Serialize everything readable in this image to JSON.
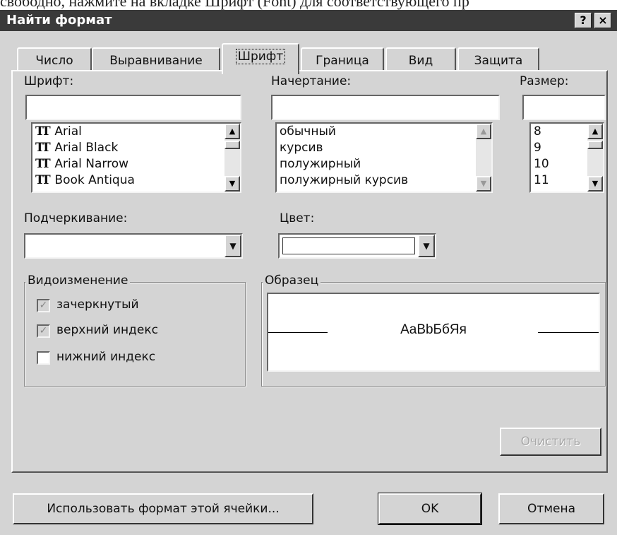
{
  "document_strip": {
    "text": "свободно, нажмите на вкладке Шрифт (Font) для соответствующего пр"
  },
  "titlebar": {
    "title": "Найти формат",
    "help_label": "?",
    "close_label": "×"
  },
  "tabs": [
    {
      "label": "Число"
    },
    {
      "label": "Выравнивание"
    },
    {
      "label": "Шрифт",
      "active": true
    },
    {
      "label": "Граница"
    },
    {
      "label": "Вид"
    },
    {
      "label": "Защита"
    }
  ],
  "font": {
    "label": "Шрифт:",
    "value": "",
    "icon": "truetype-icon",
    "icon_glyph": "TT",
    "items": [
      "Arial",
      "Arial Black",
      "Arial Narrow",
      "Book Antiqua"
    ]
  },
  "style": {
    "label": "Начертание:",
    "value": "",
    "items": [
      "обычный",
      "курсив",
      "полужирный",
      "полужирный курсив"
    ]
  },
  "size": {
    "label": "Размер:",
    "value": "",
    "items": [
      "8",
      "9",
      "10",
      "11"
    ]
  },
  "underline": {
    "label": "Подчеркивание:",
    "value": ""
  },
  "color": {
    "label": "Цвет:",
    "value": ""
  },
  "effects": {
    "title": "Видоизменение",
    "items": [
      {
        "label": "зачеркнутый",
        "checked": true
      },
      {
        "label": "верхний индекс",
        "checked": true
      },
      {
        "label": "нижний индекс",
        "checked": false
      }
    ]
  },
  "preview": {
    "title": "Образец",
    "sample_text": "AaBbБбЯя"
  },
  "buttons": {
    "clear": "Очистить",
    "use_cell_format": "Использовать формат этой ячейки...",
    "ok": "OK",
    "cancel": "Отмена"
  },
  "glyphs": {
    "arrow_up": "▲",
    "arrow_down": "▼",
    "check": "✓"
  }
}
